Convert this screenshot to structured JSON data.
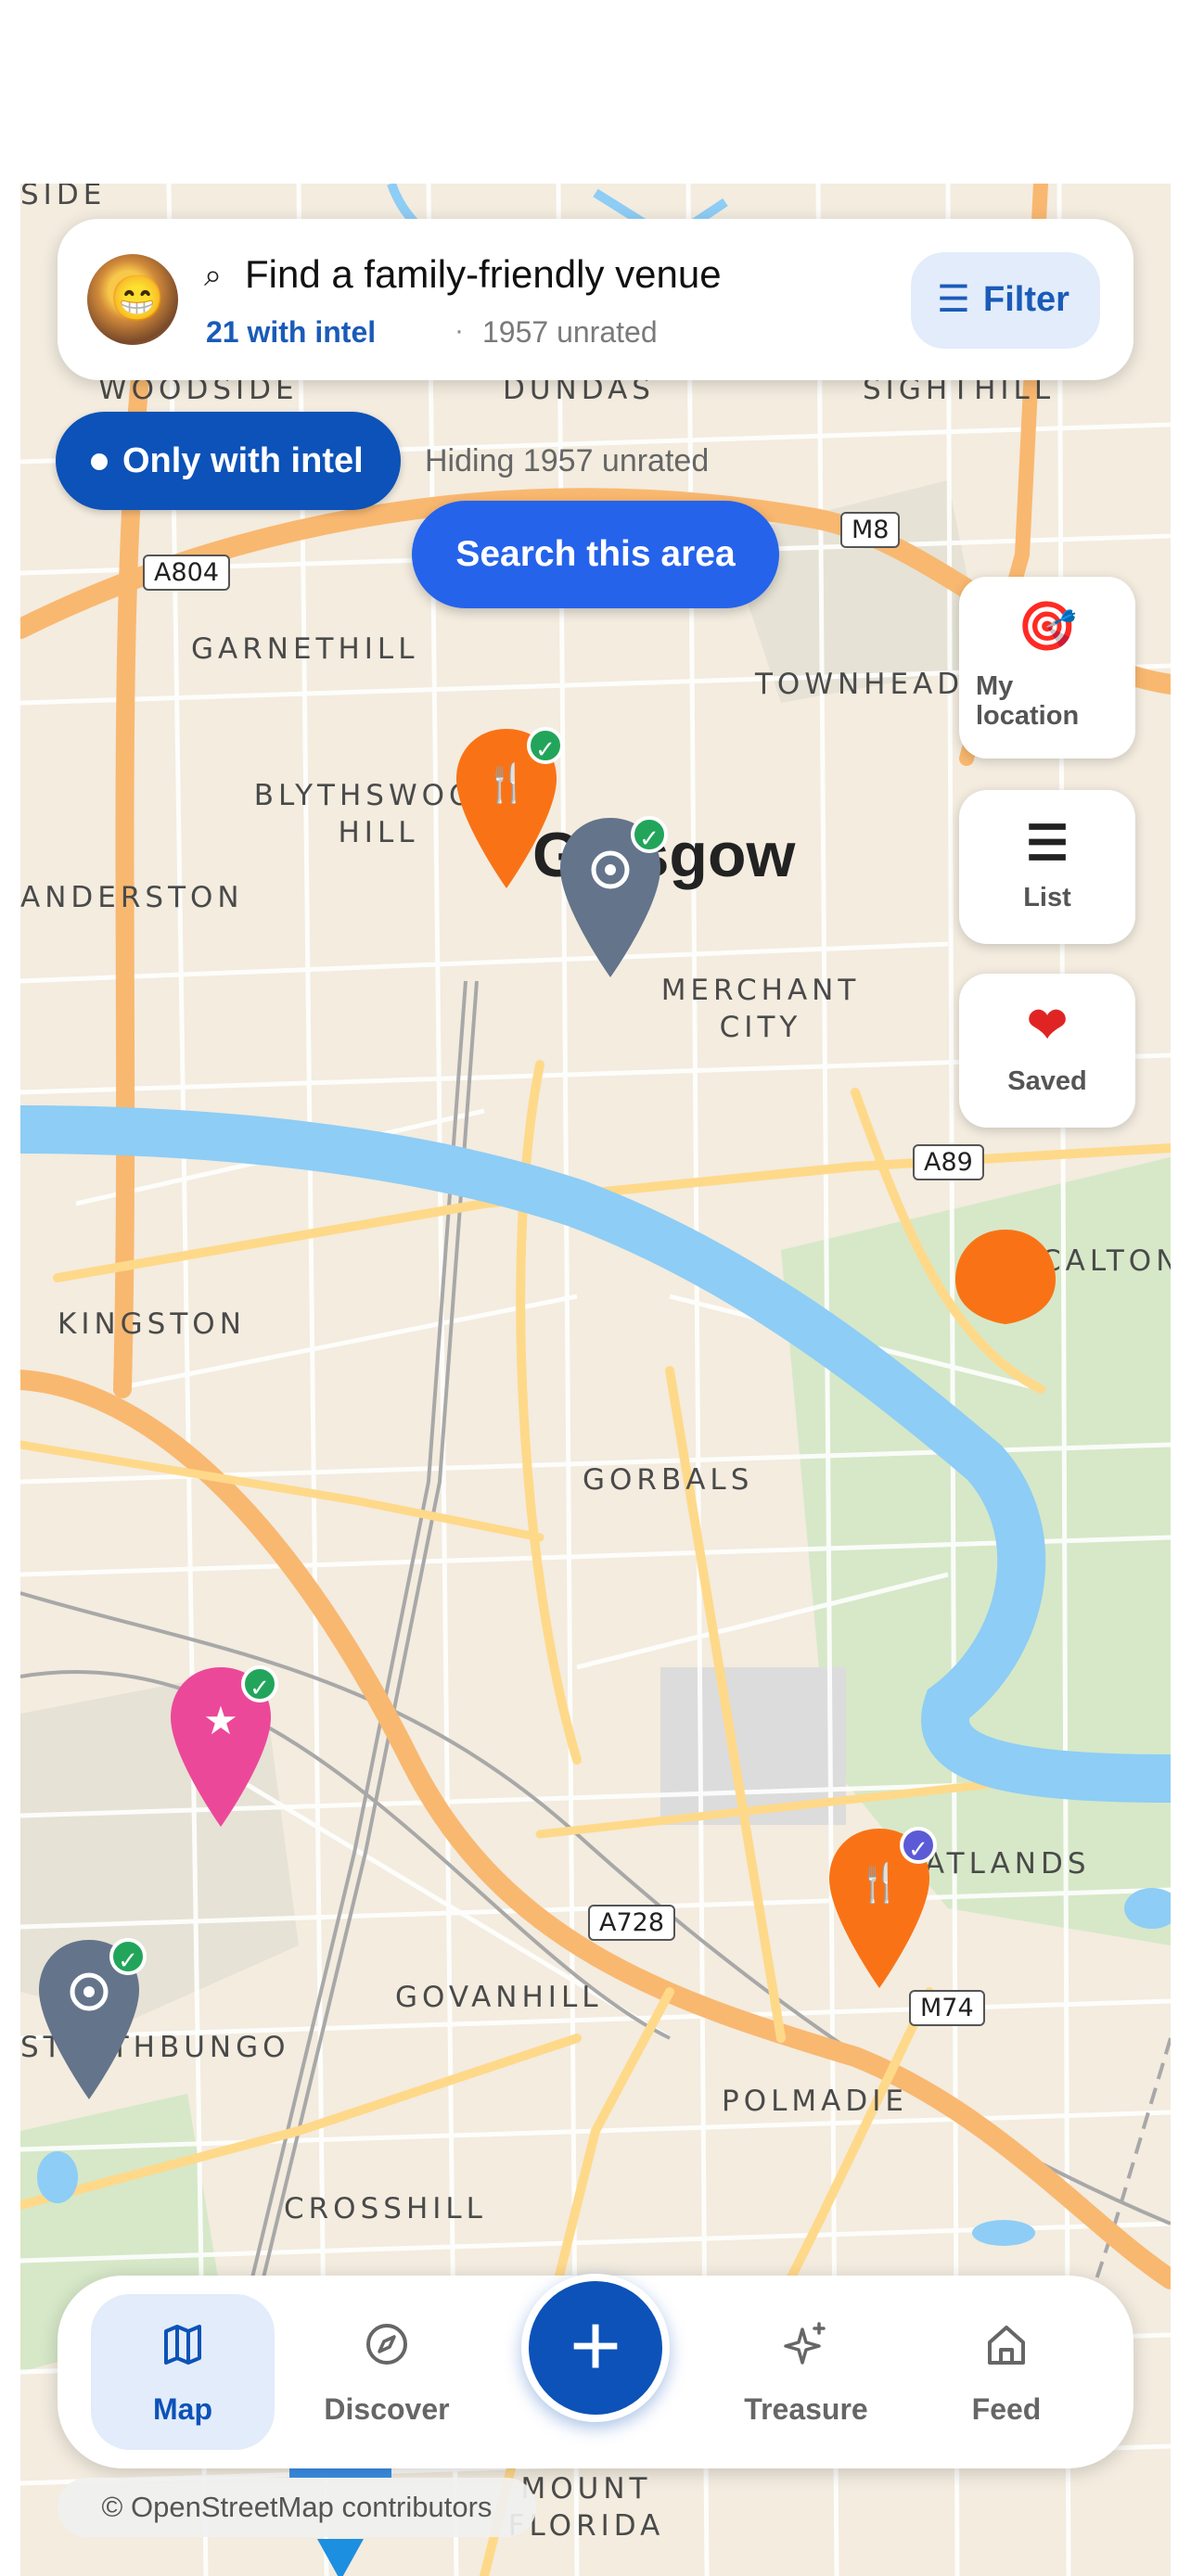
{
  "search": {
    "title": "Find a family-friendly venue",
    "intel_count": "21 with intel",
    "separator": "·",
    "unrated_count": "1957 unrated",
    "filter_label": "Filter"
  },
  "intel_filter": {
    "label": "Only with intel",
    "hiding_text": "Hiding 1957 unrated"
  },
  "search_area_label": "Search this area",
  "side_buttons": {
    "location_label": "My location",
    "list_label": "List",
    "saved_label": "Saved"
  },
  "map_labels": {
    "woodside": "WOODSIDE",
    "dundas": "DUNDAS",
    "sighthill": "SIGHTHILL",
    "garnethill": "GARNETHILL",
    "townhead": "TOWNHEAD",
    "blythswood": "BLYTHSWOOD HILL",
    "glasgow": "Glasgow",
    "anderston": "ANDERSTON",
    "merchant_city": "MERCHANT CITY",
    "kingston": "KINGSTON",
    "calton": "CALTON",
    "gorbals": "GORBALS",
    "oatlands": "OATLANDS",
    "govanhill": "GOVANHILL",
    "strathbungo": "STRATHBUNGO",
    "polmadie": "POLMADIE",
    "crosshill": "CROSSHILL",
    "mount_florida": "MOUNT FLORIDA",
    "road_a804": "A804",
    "road_m8": "M8",
    "road_a89": "A89",
    "road_a728": "A728",
    "road_m74": "M74",
    "side_label": "SIDE"
  },
  "nav": {
    "map": "Map",
    "discover": "Discover",
    "treasure": "Treasure",
    "feed": "Feed"
  },
  "attribution": "© OpenStreetMap contributors",
  "colors": {
    "primary": "#0c52b8",
    "accent": "#2563eb",
    "pin_food": "#f97316",
    "pin_place": "#64748b",
    "pin_star": "#ec4899",
    "verified_green": "#22a55a",
    "verified_blue": "#5b5bd6",
    "river": "#8ecdf5"
  },
  "icons": {
    "search": "search-icon",
    "filter": "filter-lines-icon",
    "location": "target-icon",
    "list": "list-icon",
    "saved": "heart-icon",
    "map": "map-icon",
    "discover": "compass-icon",
    "add": "plus-icon",
    "treasure": "sparkles-icon",
    "feed": "home-icon"
  }
}
